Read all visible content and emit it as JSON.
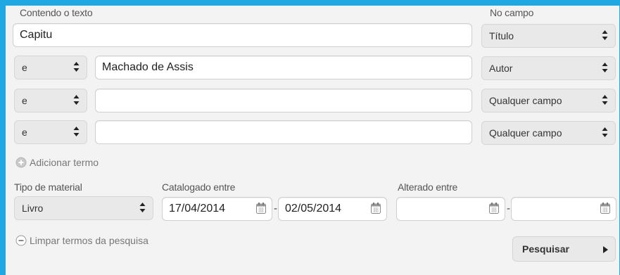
{
  "labels": {
    "contendo": "Contendo o texto",
    "no_campo": "No campo",
    "tipo_material": "Tipo de material",
    "catalogado": "Catalogado entre",
    "alterado": "Alterado entre"
  },
  "rows": [
    {
      "operator": "",
      "text": "Capitu",
      "field": "Título"
    },
    {
      "operator": "e",
      "text": "Machado de Assis",
      "field": "Autor"
    },
    {
      "operator": "e",
      "text": "",
      "field": "Qualquer campo"
    },
    {
      "operator": "e",
      "text": "",
      "field": "Qualquer campo"
    }
  ],
  "add_term": "Adicionar termo",
  "material": "Livro",
  "catalog_from": "17/04/2014",
  "catalog_to": "02/05/2014",
  "altered_from": "",
  "altered_to": "",
  "range_separator": "-",
  "clear_terms": "Limpar termos da pesquisa",
  "search_button": "Pesquisar",
  "icons": {
    "add": "plus-circle-icon",
    "clear": "minus-circle-icon",
    "calendar": "calendar-icon",
    "select": "updown-arrows-icon",
    "button": "triangle-right-icon"
  },
  "colors": {
    "frame": "#1fa8e1",
    "panel": "#f3f3f3"
  }
}
